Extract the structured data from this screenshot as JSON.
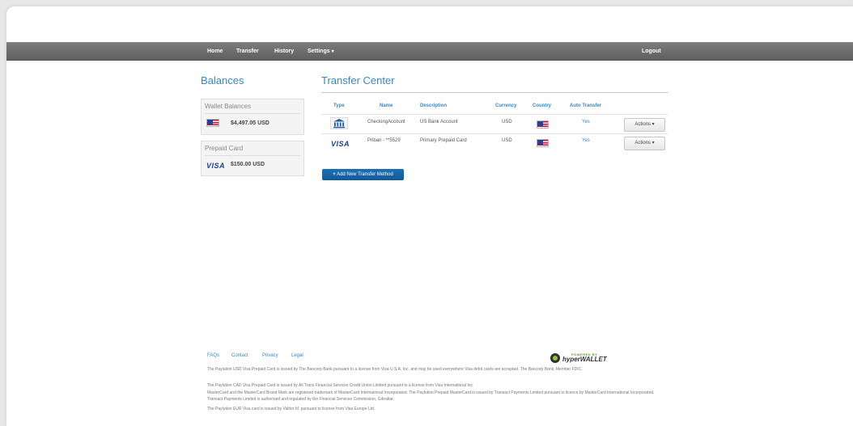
{
  "nav": {
    "items": [
      "Home",
      "Transfer",
      "History",
      "Settings"
    ],
    "logout": "Logout"
  },
  "balances": {
    "title": "Balances",
    "wallet_label": "Wallet Balances",
    "wallet_amount": "$4,497.05 USD",
    "prepaid_label": "Prepaid Card",
    "prepaid_amount": "$150.00 USD"
  },
  "transfer_center": {
    "title": "Transfer Center",
    "headers": [
      "Type",
      "Name",
      "Description",
      "Currency",
      "Country",
      "Auto Transfer"
    ],
    "rows": [
      {
        "name": "CheckingAccount",
        "description": "US Bank Account",
        "currency": "USD",
        "auto": "Yes",
        "actions": "Actions"
      },
      {
        "name": "Priban - **5529",
        "description": "Primary Prepaid Card",
        "currency": "USD",
        "auto": "Yes",
        "actions": "Actions"
      }
    ],
    "add_button": "Add New Transfer Method"
  },
  "icons": {
    "visa_text": "VISA"
  },
  "footer": {
    "links": [
      "FAQs",
      "Contact",
      "Privacy",
      "Legal"
    ],
    "powered_by": "POWERED BY",
    "brand": "hyperWALLET",
    "legal_lines": [
      "The Paylution USD Visa Prepaid Card is issued by The Bancorp Bank pursuant to a license from Visa U.S.A. Inc. and may be used everywhere Visa debit cards are accepted. The Bancorp Bank; Member FDIC.",
      "The Paylution CAD Visa Prepaid Card is issued by All Trans Financial Services Credit Union Limited pursuant to a license from Visa International Inc.",
      "MasterCard and the MasterCard Brand Mark are registered trademark of MasterCard International Incorporated. The Paylution Prepaid MasterCard is issued by Transact Payments Limited pursuant to licence by MasterCard International Incorporated. Transact Payments Limited is authorised and regulated by the Financial Services Commission, Gibraltar.",
      "The Paylution EUR Visa card is issued by Valitor hf. pursuant to license from Visa Europe Ltd."
    ]
  },
  "colors": {
    "accent": "#3a86c5",
    "navbar": "#6a6a6a",
    "button": "#1764a6"
  }
}
